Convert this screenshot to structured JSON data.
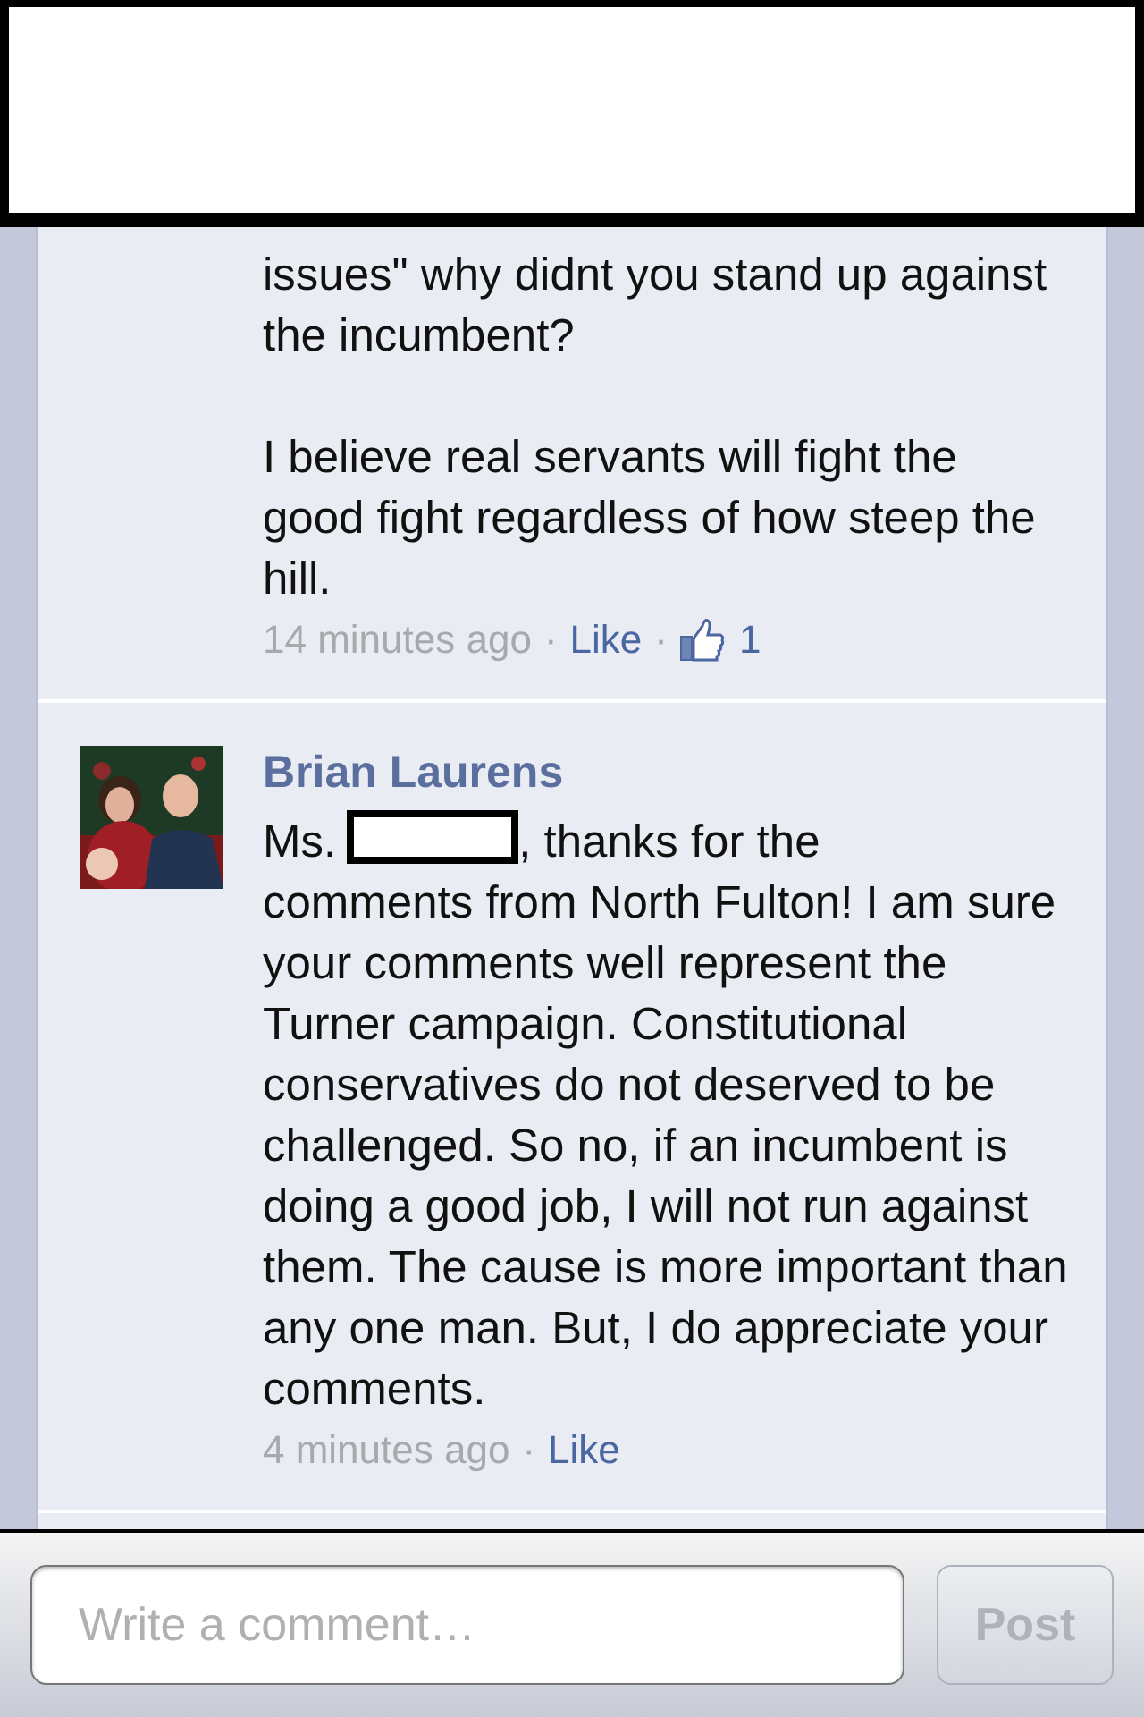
{
  "comments": [
    {
      "paragraphs": [
        {
          "parts": [
            {
              "kind": "block",
              "text": "issues\" why didnt you stand up against the incumbent?"
            }
          ]
        },
        {
          "parts": [
            {
              "kind": "block",
              "text": "I believe real servants will fight the good fight regardless of how steep the hill."
            }
          ]
        }
      ],
      "time": "14 minutes ago",
      "sep1": "·",
      "like": "Like",
      "sep2": "·",
      "likes": "1"
    },
    {
      "author": "Brian Laurens",
      "avatar": {
        "kind": "picture"
      },
      "paragraphs": [
        {
          "parts": [
            {
              "kind": "text",
              "text": "Ms."
            },
            {
              "kind": "redaction"
            },
            {
              "kind": "text",
              "text": ", thanks for the"
            },
            {
              "kind": "block",
              "text": "comments from North Fulton!  I am sure your comments well represent the Turner campaign. Constitutional conservatives do not deserved to be challenged.  So no, if an incumbent is doing a good job, I will not run against them.  The cause is more important than any one man.  But, I do appreciate your comments."
            }
          ]
        }
      ],
      "time": "4 minutes ago",
      "sep1": "·",
      "like": "Like"
    }
  ],
  "composer": {
    "placeholder": "Write a comment…",
    "button": "Post",
    "disabled": true
  }
}
